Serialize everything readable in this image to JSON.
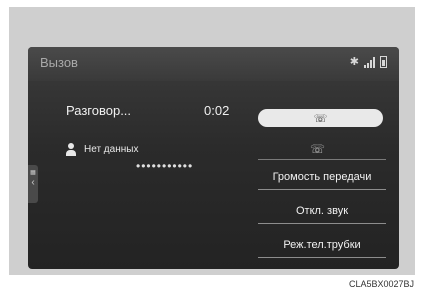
{
  "screen": {
    "title": "Вызов",
    "call_status": "Разговор...",
    "call_time": "0:02",
    "contact_name": "Нет данных",
    "number_dots": "•••••••••••",
    "buttons": {
      "volume": "Громость передачи",
      "mute": "Откл. звук",
      "handset": "Реж.тел.трубки"
    }
  },
  "caption": "CLA5BX0027BJ",
  "colors": {
    "screen_bg": "#2b2b2b",
    "frame_bg": "#cfcfcf",
    "text_light": "#f0f0f0",
    "title_text": "#a9a9a9",
    "end_call_bg": "#e9e9e9"
  },
  "icons": {
    "bluetooth": "bluetooth-icon",
    "signal": "signal-strength-icon",
    "battery": "battery-icon",
    "person": "person-icon",
    "end_call": "end-call-phone-icon",
    "phone": "phone-icon",
    "back": "back-arrow-icon"
  }
}
